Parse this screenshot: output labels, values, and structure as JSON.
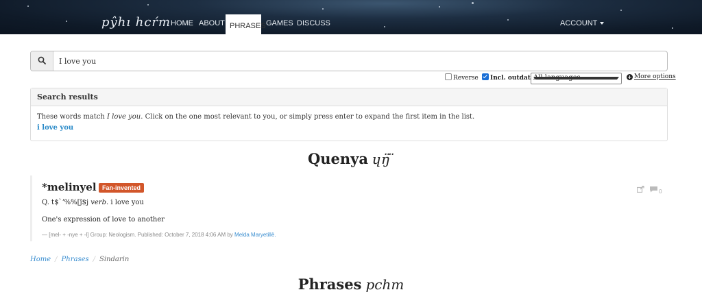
{
  "nav": {
    "brand": "pŷhı hcŕm",
    "links": [
      "HOME",
      "ABOUT",
      "PHRASES",
      "GAMES",
      "DISCUSS"
    ],
    "active": "PHRASES",
    "account": "ACCOUNT"
  },
  "search": {
    "value": "I love you",
    "reverse_label": "Reverse",
    "outdated_label": "Incl. outdated",
    "reverse_checked": false,
    "outdated_checked": true,
    "language_selected": "All languages",
    "more_options": "More options"
  },
  "results": {
    "header": "Search results",
    "text_before": "These words match ",
    "query": "I love you",
    "text_after": ". Click on the one most relevant to you, or simply press enter to expand the first item in the list.",
    "link": "i love you"
  },
  "quenya_heading": {
    "title": "Quenya",
    "tengwar": "ɥŋ̈ ̈"
  },
  "entry": {
    "title": "*melinyel",
    "badge": "Fan-invented",
    "badge_color": "#d2562a",
    "def_prefix": "Q. t$`ʼ%%[j̃$j",
    "pos": "verb.",
    "gloss": "i love you",
    "description": "One's expression of love to another",
    "meta_text": "— [mel- + -nye + -l] Group: Neologism. Published: October 7, 2018 4:06 AM by ",
    "author": "Melda Maryetillë.",
    "comment_count": "0"
  },
  "breadcrumb": {
    "home": "Home",
    "phrases": "Phrases",
    "current": "Sindarin"
  },
  "phrases_heading": {
    "title": "Phrases",
    "tengwar": "pchm"
  }
}
